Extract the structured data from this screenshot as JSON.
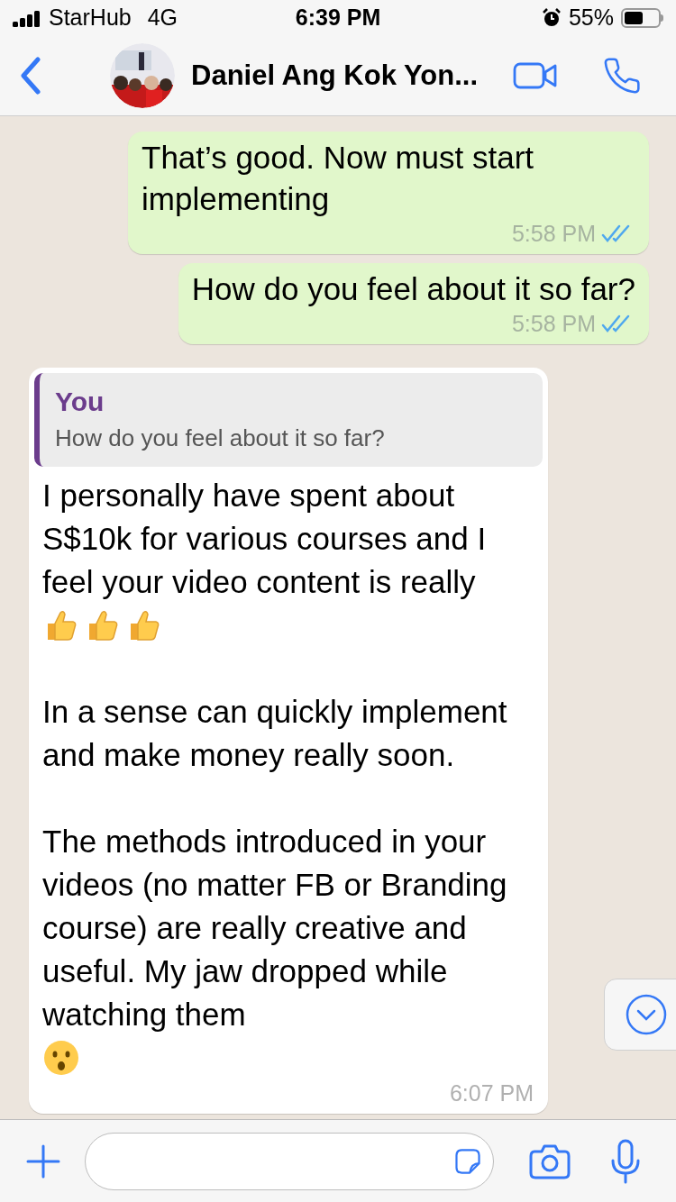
{
  "status_bar": {
    "carrier": "StarHub",
    "network": "4G",
    "time": "6:39 PM",
    "alarm": true,
    "battery": "55%"
  },
  "header": {
    "contact_name": "Daniel Ang Kok Yon..."
  },
  "messages": [
    {
      "kind": "outgoing",
      "text": "That’s good. Now must start implementing",
      "time": "5:58 PM",
      "read": true
    },
    {
      "kind": "outgoing",
      "text": "How do you feel about it so far?",
      "time": "5:58 PM",
      "read": true
    },
    {
      "kind": "incoming",
      "quote": {
        "author": "You",
        "text": "How do you feel about it so far?"
      },
      "paragraphs": [
        {
          "text": "I personally have spent about S$10k for various courses and I feel your video content is really",
          "emojis": [
            {
              "kind": "thumbs_up"
            },
            {
              "kind": "thumbs_up"
            },
            {
              "kind": "thumbs_up"
            }
          ]
        },
        {
          "text": "In a sense can quickly implement and make money really soon."
        },
        {
          "text": "The methods introduced in your videos (no matter FB or Branding course) are really creative and useful. My jaw dropped while watching them",
          "emojis": [
            {
              "kind": "surprised"
            }
          ]
        }
      ],
      "time": "6:07 PM"
    }
  ]
}
